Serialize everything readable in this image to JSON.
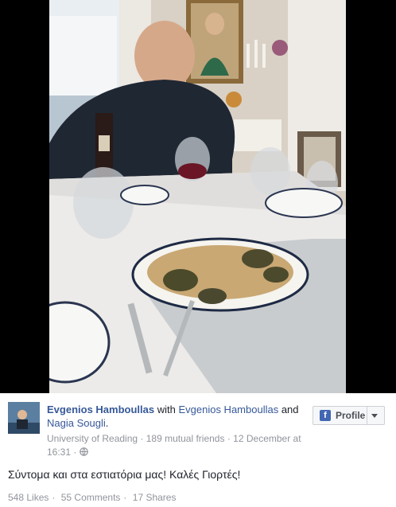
{
  "post": {
    "author": "Evgenios Hamboullas",
    "with_word": "with",
    "with_name_1": "Evgenios Hamboullas",
    "and_word": "and",
    "with_name_2": "Nagia Sougli",
    "with_period": ".",
    "school": "University of Reading",
    "mutual_friends": "189 mutual friends",
    "date": "12 December at",
    "time": "16:31",
    "text": "Σύντομα και στα εστιατόρια μας! Καλές Γιορτές!",
    "likes": "548 Likes",
    "comments": "55 Comments",
    "shares": "17 Shares"
  },
  "profile_button": {
    "label": "Profile",
    "fb_glyph": "f"
  },
  "icons": {
    "privacy": "globe-icon",
    "fb_logo": "facebook-icon",
    "dropdown": "chevron-down-icon"
  },
  "colors": {
    "link": "#365899",
    "muted": "#90949c",
    "text": "#1d2129",
    "fb_blue": "#4267b2"
  }
}
